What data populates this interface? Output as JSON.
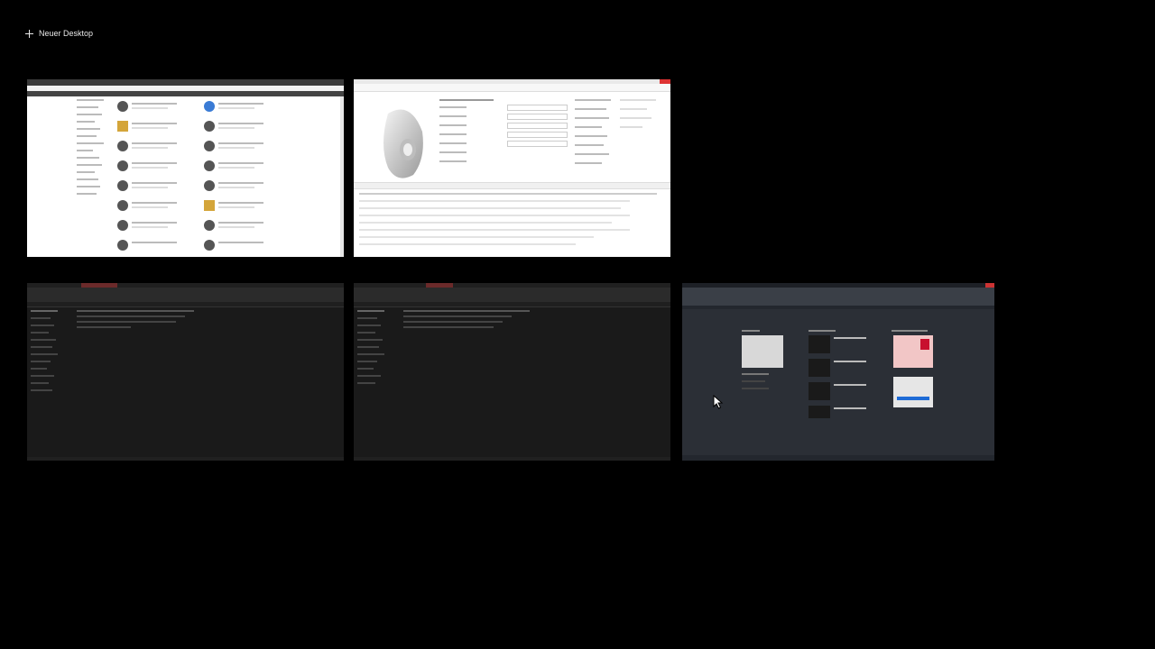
{
  "new_desktop": {
    "label": "Neuer Desktop"
  },
  "windows": [
    {
      "id": "browser-product-list"
    },
    {
      "id": "cad-part-properties"
    },
    {
      "id": "file-explorer-1"
    },
    {
      "id": "file-explorer-2"
    },
    {
      "id": "autocad-start"
    }
  ]
}
